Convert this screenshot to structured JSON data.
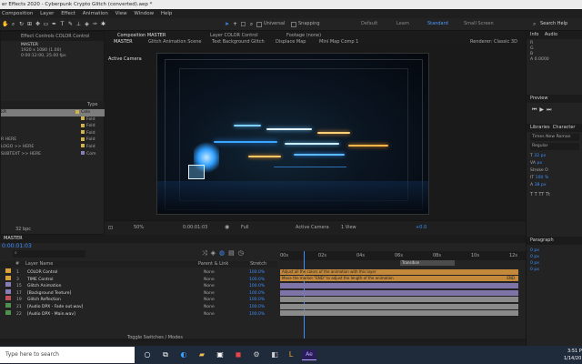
{
  "title_bar": {
    "text": "er Effects 2020 - Cyberpunk Crypto Glitch (converted).aep *"
  },
  "menu": [
    "Composition",
    "Layer",
    "Effect",
    "Animation",
    "View",
    "Window",
    "Help"
  ],
  "toolbar": {
    "workspaces": [
      "Default",
      "Learn",
      "Standard",
      "Small Screen"
    ],
    "active_workspace": "Standard",
    "search_label": "Search Help",
    "snapping_label": "Snapping",
    "universal_label": "Universal"
  },
  "project_panel": {
    "effect_controls_tab": "Effect Controls COLOR Control",
    "comp_name": "MASTER",
    "comp_details": [
      "1920 x 1080 (1.00)",
      "0:00:12:00, 25.00 fps"
    ],
    "type_header": "Type",
    "items": [
      {
        "name": "ER",
        "type": "Colo"
      },
      {
        "name": "",
        "type": "Fold"
      },
      {
        "name": "",
        "type": "Fold"
      },
      {
        "name": "",
        "type": "Fold"
      },
      {
        "name": "R HERE",
        "type": "Fold"
      },
      {
        "name": "LOGO >> HERE",
        "type": "Fold"
      },
      {
        "name": "SUBTEXT >> HERE",
        "type": "Com"
      }
    ],
    "footer_text": "32 bpc"
  },
  "viewer": {
    "tabs": [
      "Composition MASTER",
      "Layer COLOR Control",
      "Footage (none)"
    ],
    "subtabs": [
      "MASTER",
      "Glitch Animation Scene",
      "Text Background Glitch",
      "Displace Map",
      "Mini Map Comp 1"
    ],
    "renderer_label": "Renderer: Classic 3D",
    "active_camera": "Active Camera",
    "zoom": "50%",
    "timecode": "0:00:01:03",
    "resolution": "Full",
    "camera_select": "Active Camera",
    "view_select": "1 View",
    "offset": "+0.0"
  },
  "timeline": {
    "tab_label": "MASTER",
    "timecode": "0:00:01:03",
    "columns": {
      "num": "#",
      "layer_name": "Layer Name",
      "parent": "Parent & Link",
      "stretch": "Stretch"
    },
    "ruler": [
      "00s",
      "02s",
      "04s",
      "06s",
      "08s",
      "10s",
      "12s"
    ],
    "layers": [
      {
        "num": "1",
        "name": "COLOR Control",
        "parent": "None",
        "stretch": "100.0%",
        "color": "#d9a13b"
      },
      {
        "num": "3",
        "name": "TIME Control",
        "parent": "None",
        "stretch": "100.0%",
        "color": "#d9a13b"
      },
      {
        "num": "15",
        "name": "Glitch Animation",
        "parent": "None",
        "stretch": "100.0%",
        "color": "#8b7eb8"
      },
      {
        "num": "17",
        "name": "[Background Texture]",
        "parent": "None",
        "stretch": "100.0%",
        "color": "#8b7eb8"
      },
      {
        "num": "19",
        "name": "Glitch Reflection",
        "parent": "None",
        "stretch": "100.0%",
        "color": "#c0505a"
      },
      {
        "num": "21",
        "name": "[Audio DPX - Fade out.wav]",
        "parent": "None",
        "stretch": "100.0%",
        "color": "#4f8f4f"
      },
      {
        "num": "22",
        "name": "[Audio DPX - Main.wav]",
        "parent": "None",
        "stretch": "100.0%",
        "color": "#4f8f4f"
      }
    ],
    "bar_notes": [
      "Adjust all the colors of the animation with this layer",
      "Move the marker \"END\" to adjust the length of the animation"
    ],
    "end_marker": "END",
    "transition_label": "Transition",
    "footer_label": "Toggle Switches / Modes"
  },
  "right_panel": {
    "info_tab": "Info",
    "audio_tab": "Audio",
    "rgb": [
      {
        "label": "R",
        "value": ""
      },
      {
        "label": "G",
        "value": ""
      },
      {
        "label": "B",
        "value": ""
      },
      {
        "label": "A",
        "value": "0.0000"
      }
    ],
    "preview_title": "Preview",
    "libraries_tab": "Libraries",
    "character_tab": "Character",
    "font_name": "Times New Roman",
    "font_style": "Regular",
    "font_size": "32 px",
    "stroke_label": "Stroke O",
    "tracking": "px",
    "scale_v": "100 %",
    "baseline": "38 px",
    "paragraph_title": "Paragraph",
    "para_values": [
      "0 px",
      "0 px",
      "0 px",
      "0 px"
    ]
  },
  "taskbar": {
    "search_placeholder": "Type here to search",
    "time": "3:51 P",
    "date": "1/14/20"
  }
}
